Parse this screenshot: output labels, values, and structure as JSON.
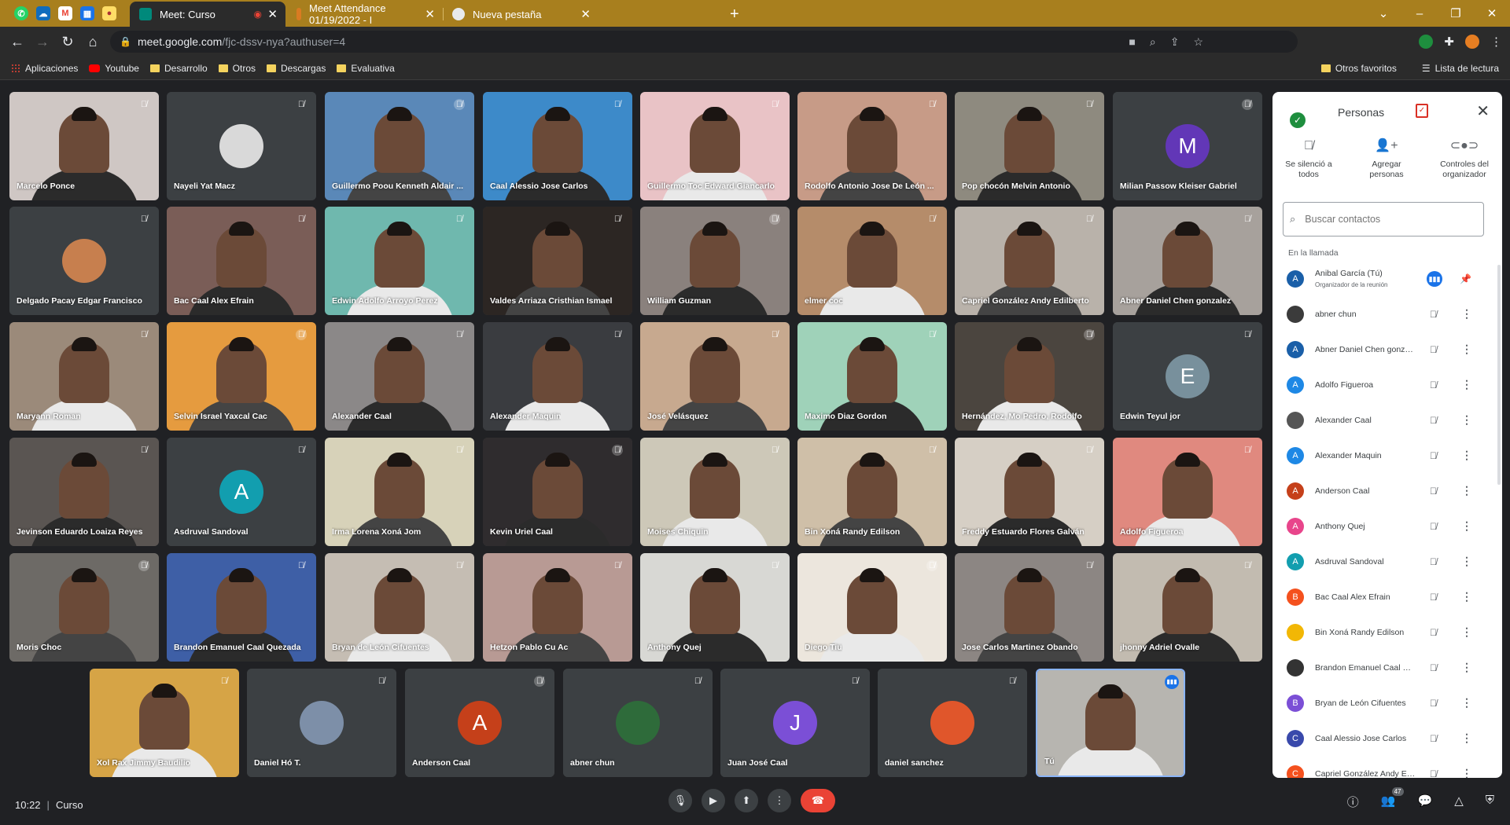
{
  "browser": {
    "tabs": [
      {
        "title": "Meet: Curso",
        "active": true
      },
      {
        "title": "Meet Attendance 01/19/2022 - I"
      },
      {
        "title": "Nueva pestaña"
      }
    ],
    "new_tab": "+",
    "url_host": "meet.google.com",
    "url_path": "/fjc-dssv-nya?authuser=4",
    "bookmarks": [
      "Aplicaciones",
      "Youtube",
      "Desarrollo",
      "Otros",
      "Descargas",
      "Evaluativa"
    ],
    "bookmarks_right": [
      "Otros favoritos",
      "Lista de lectura"
    ]
  },
  "tiles": [
    {
      "name": "Marcelo Ponce",
      "bg": "#cfc7c4",
      "kind": "video"
    },
    {
      "name": "Nayeli Yat Macz",
      "bg": "#3c4043",
      "kind": "avatar-img",
      "av": "#d9d9d9"
    },
    {
      "name": "Guillermo Poou Kenneth Aldair ...",
      "bg": "#5a88b8",
      "kind": "video"
    },
    {
      "name": "Caal Alessio Jose Carlos",
      "bg": "#3d8ac9",
      "kind": "video"
    },
    {
      "name": "Guillermo Toc Edward Giancarlo",
      "bg": "#e9c3c6",
      "kind": "video"
    },
    {
      "name": "Rodolfo Antonio Jose De León ...",
      "bg": "#c79b87",
      "kind": "video"
    },
    {
      "name": "Pop chocón Melvin Antonio",
      "bg": "#8e8a7f",
      "kind": "video"
    },
    {
      "name": "Milian Passow Kleiser Gabriel",
      "bg": "#3c4043",
      "kind": "letter",
      "letter": "M",
      "av": "#6237b7"
    },
    {
      "name": "Delgado Pacay Edgar Francisco",
      "bg": "#3c4043",
      "kind": "avatar-img",
      "av": "#c77f4e"
    },
    {
      "name": "Bac Caal Alex Efrain",
      "bg": "#7a5d57",
      "kind": "video"
    },
    {
      "name": "Edwin Adolfo Arroyo Perez",
      "bg": "#6fb8ae",
      "kind": "video"
    },
    {
      "name": "Valdes Arriaza Cristhian Ismael",
      "bg": "#2c2623",
      "kind": "video"
    },
    {
      "name": "William Guzman",
      "bg": "#8a817d",
      "kind": "video"
    },
    {
      "name": "elmer coc",
      "bg": "#b58c6a",
      "kind": "video"
    },
    {
      "name": "Capriel González Andy Edilberto",
      "bg": "#b9b2aa",
      "kind": "video"
    },
    {
      "name": "Abner Daniel Chen gonzalez",
      "bg": "#a7a19c",
      "kind": "video"
    },
    {
      "name": "Maryann Roman",
      "bg": "#9b8a7a",
      "kind": "video"
    },
    {
      "name": "Selvin Israel Yaxcal Cac",
      "bg": "#e59b3f",
      "kind": "video"
    },
    {
      "name": "Alexander Caal",
      "bg": "#8b8888",
      "kind": "video"
    },
    {
      "name": "Alexander Maquin",
      "bg": "#3a3c40",
      "kind": "video"
    },
    {
      "name": "José Velásquez",
      "bg": "#c7a98f",
      "kind": "video"
    },
    {
      "name": "Maximo Diaz Gordon",
      "bg": "#9fd2b9",
      "kind": "video"
    },
    {
      "name": "Hernández, Mo Pedro, Rodolfo",
      "bg": "#4b453f",
      "kind": "video"
    },
    {
      "name": "Edwin Teyul jor",
      "bg": "#3c4043",
      "kind": "letter",
      "letter": "E",
      "av": "#78909c"
    },
    {
      "name": "Jevinson Eduardo Loaiza Reyes",
      "bg": "#5a5552",
      "kind": "video"
    },
    {
      "name": "Asdruval Sandoval",
      "bg": "#3c4043",
      "kind": "letter",
      "letter": "A",
      "av": "#129eaf"
    },
    {
      "name": "Irma Lorena Xoná Jom",
      "bg": "#d7d2b9",
      "kind": "video"
    },
    {
      "name": "Kevin Uriel Caal",
      "bg": "#2f2c2e",
      "kind": "video"
    },
    {
      "name": "Moises Chiquin",
      "bg": "#cdc8b8",
      "kind": "video"
    },
    {
      "name": "Bin Xoná Randy Edilson",
      "bg": "#cfbfa8",
      "kind": "video"
    },
    {
      "name": "Freddy Estuardo Flores Galván",
      "bg": "#d6cfc5",
      "kind": "video"
    },
    {
      "name": "Adolfo Figueroa",
      "bg": "#e0897f",
      "kind": "video"
    },
    {
      "name": "Moris Choc",
      "bg": "#6d6a66",
      "kind": "video"
    },
    {
      "name": "Brandon Emanuel Caal Quezada",
      "bg": "#3e5fa6",
      "kind": "video"
    },
    {
      "name": "Bryan de León Cifuentes",
      "bg": "#c5bdb3",
      "kind": "video"
    },
    {
      "name": "Hetzon Pablo Cu Ac",
      "bg": "#b89a94",
      "kind": "video"
    },
    {
      "name": "Anthony Quej",
      "bg": "#d8d8d4",
      "kind": "video"
    },
    {
      "name": "Diego Tiu",
      "bg": "#ece6dd",
      "kind": "video"
    },
    {
      "name": "Jose Carlos Martinez Obando",
      "bg": "#8c8683",
      "kind": "video"
    },
    {
      "name": "jhonny Adriel Ovalle",
      "bg": "#c2bbb0",
      "kind": "video"
    },
    {
      "name": "Xol Rax Jimmy Baudilio",
      "bg": "#d6a446",
      "kind": "video"
    },
    {
      "name": "Daniel Hó T.",
      "bg": "#3c4043",
      "kind": "avatar-img",
      "av": "#7d8fa8"
    },
    {
      "name": "Anderson Caal",
      "bg": "#3c4043",
      "kind": "letter",
      "letter": "A",
      "av": "#c5401a"
    },
    {
      "name": "abner chun",
      "bg": "#3c4043",
      "kind": "avatar-img",
      "av": "#2e6b3a"
    },
    {
      "name": "Juan José Caal",
      "bg": "#3c4043",
      "kind": "letter",
      "letter": "J",
      "av": "#7b4fd6"
    },
    {
      "name": "daniel sanchez",
      "bg": "#3c4043",
      "kind": "avatar-img",
      "av": "#e0562b"
    },
    {
      "name": "Tú",
      "bg": "#b7b5b0",
      "kind": "self"
    }
  ],
  "panel": {
    "title": "Personas",
    "actions": [
      "Se silenció a todos",
      "Agregar personas",
      "Controles del organizador"
    ],
    "search_placeholder": "Buscar contactos",
    "section": "En la llamada",
    "people": [
      {
        "name": "Anibal García (Tú)",
        "sub": "Organizador de la reunión",
        "letter": "A",
        "color": "#1a5fa8",
        "host": true
      },
      {
        "name": "abner chun",
        "letter": "",
        "color": "#3b3b3b"
      },
      {
        "name": "Abner Daniel Chen gonzalez",
        "letter": "A",
        "color": "#1a5fa8"
      },
      {
        "name": "Adolfo Figueroa",
        "letter": "A",
        "color": "#1e88e5"
      },
      {
        "name": "Alexander Caal",
        "letter": "",
        "color": "#555555"
      },
      {
        "name": "Alexander Maquin",
        "letter": "A",
        "color": "#1e88e5"
      },
      {
        "name": "Anderson Caal",
        "letter": "A",
        "color": "#c5401a"
      },
      {
        "name": "Anthony Quej",
        "letter": "A",
        "color": "#e8458b"
      },
      {
        "name": "Asdruval Sandoval",
        "letter": "A",
        "color": "#129eaf"
      },
      {
        "name": "Bac Caal Alex Efrain",
        "letter": "B",
        "color": "#f4511e"
      },
      {
        "name": "Bin Xoná Randy Edilson",
        "letter": "",
        "color": "#f2b705"
      },
      {
        "name": "Brandon Emanuel Caal Que...",
        "letter": "",
        "color": "#333333"
      },
      {
        "name": "Bryan de León Cifuentes",
        "letter": "B",
        "color": "#7b4fd6"
      },
      {
        "name": "Caal Alessio Jose Carlos",
        "letter": "C",
        "color": "#3949ab"
      },
      {
        "name": "Capriel González Andy Edil...",
        "letter": "C",
        "color": "#f4511e"
      }
    ]
  },
  "bottom": {
    "time": "10:22",
    "meeting": "Curso",
    "participant_count": "47"
  }
}
